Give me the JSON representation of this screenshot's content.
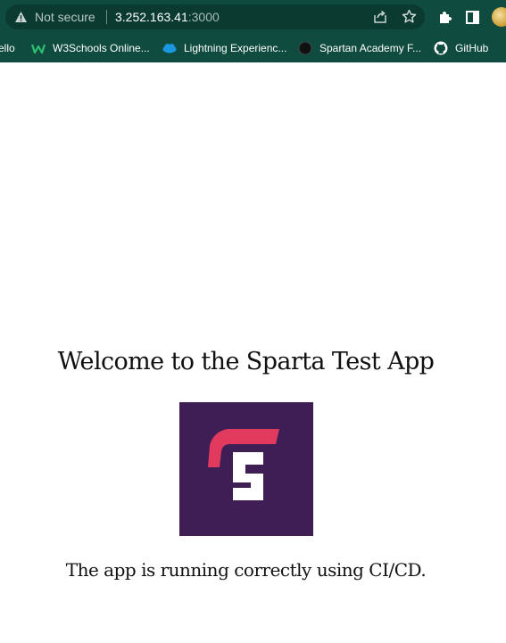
{
  "browser": {
    "security_label": "Not secure",
    "url_host": "3.252.163.41",
    "url_port": ":3000",
    "icons": [
      "warning-icon",
      "share-icon",
      "star-icon",
      "extensions-icon",
      "side-panel-icon"
    ]
  },
  "bookmarks": [
    {
      "label": "ello",
      "icon": "none"
    },
    {
      "label": "W3Schools Online...",
      "icon": "w3schools-icon"
    },
    {
      "label": "Lightning Experienc...",
      "icon": "salesforce-cloud-icon"
    },
    {
      "label": "Spartan Academy F...",
      "icon": "circle-icon"
    },
    {
      "label": "GitHub",
      "icon": "github-icon"
    }
  ],
  "page": {
    "heading": "Welcome to the Sparta Test App",
    "logo_icon": "sparta-logo",
    "message": "The app is running correctly using CI/CD."
  },
  "colors": {
    "chrome": "#0f4c3f",
    "logo_bg": "#3f1e56",
    "logo_accent": "#e23a5f"
  }
}
